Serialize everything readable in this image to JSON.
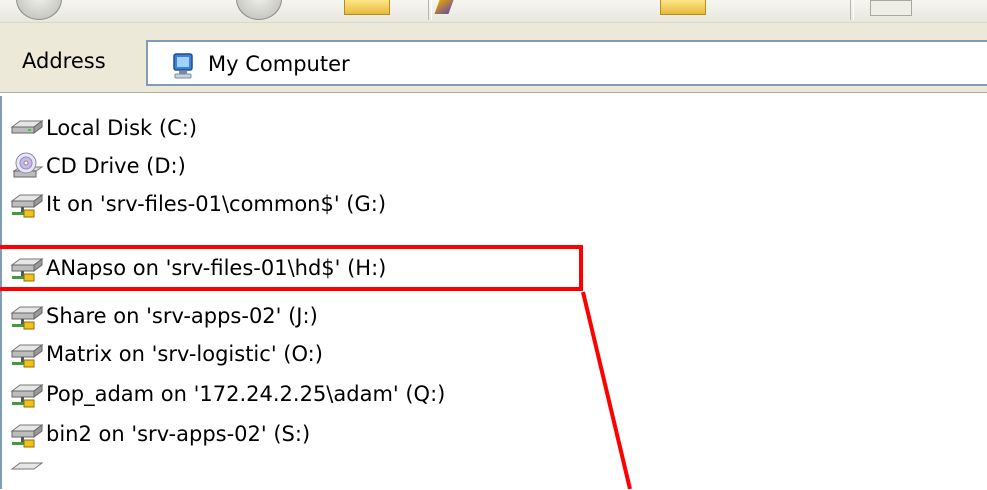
{
  "address": {
    "label": "Address",
    "value": "My Computer",
    "icon": "my-computer-icon"
  },
  "drives": [
    {
      "label": "Local Disk (C:)",
      "icon": "hard-disk-icon"
    },
    {
      "label": "CD Drive (D:)",
      "icon": "cd-drive-icon"
    },
    {
      "label": "It on 'srv-files-01\\common$' (G:)",
      "icon": "network-drive-icon"
    },
    {
      "label": "ANapso on 'srv-files-01\\hd$' (H:)",
      "icon": "network-drive-icon"
    },
    {
      "label": "Share on 'srv-apps-02' (J:)",
      "icon": "network-drive-icon"
    },
    {
      "label": "Matrix on 'srv-logistic' (O:)",
      "icon": "network-drive-icon"
    },
    {
      "label": "Pop_adam on '172.24.2.25\\adam' (Q:)",
      "icon": "network-drive-icon"
    },
    {
      "label": "bin2 on 'srv-apps-02' (S:)",
      "icon": "network-drive-icon"
    }
  ],
  "annotation": {
    "highlighted_drive": "ANapso on 'srv-files-01\\hd$' (H:)",
    "color": "#ff0000"
  }
}
